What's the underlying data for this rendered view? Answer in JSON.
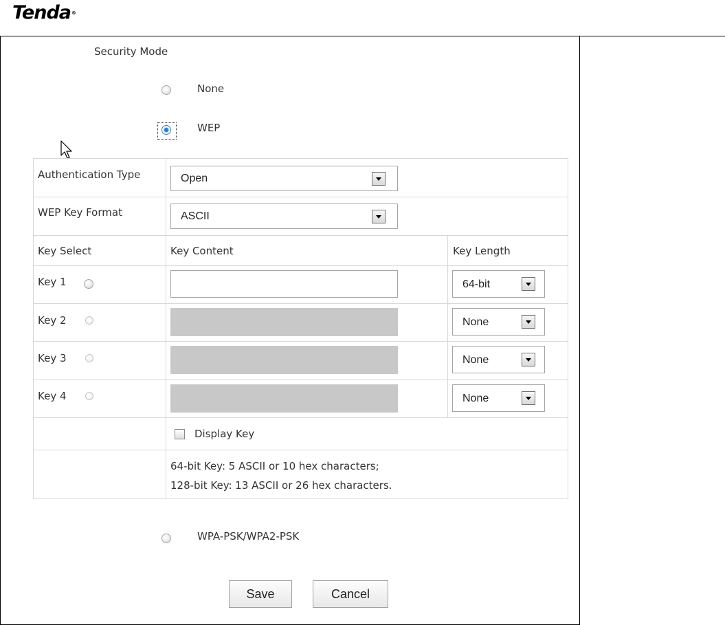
{
  "brand": {
    "logo_text": "Tenda"
  },
  "security_mode": {
    "label": "Security Mode",
    "options": {
      "none": "None",
      "wep": "WEP",
      "wpa": "WPA-PSK/WPA2-PSK"
    },
    "selected": "WEP"
  },
  "wep": {
    "auth_type_label": "Authentication Type",
    "auth_type_value": "Open",
    "key_format_label": "WEP Key Format",
    "key_format_value": "ASCII",
    "headers": {
      "key_select": "Key Select",
      "key_content": "Key Content",
      "key_length": "Key Length"
    },
    "keys": [
      {
        "label": "Key 1",
        "length": "64-bit",
        "enabled": true
      },
      {
        "label": "Key 2",
        "length": "None",
        "enabled": false
      },
      {
        "label": "Key 3",
        "length": "None",
        "enabled": false
      },
      {
        "label": "Key 4",
        "length": "None",
        "enabled": false
      }
    ],
    "display_key_label": "Display Key",
    "help_line1": "64-bit Key: 5 ASCII or 10 hex characters;",
    "help_line2": "128-bit Key: 13 ASCII or 26 hex characters."
  },
  "actions": {
    "save": "Save",
    "cancel": "Cancel"
  },
  "colors": {
    "selected_radio": "#3a8fd8",
    "disabled_field": "#c8c8c8",
    "grid_line": "#d8d8d8"
  }
}
